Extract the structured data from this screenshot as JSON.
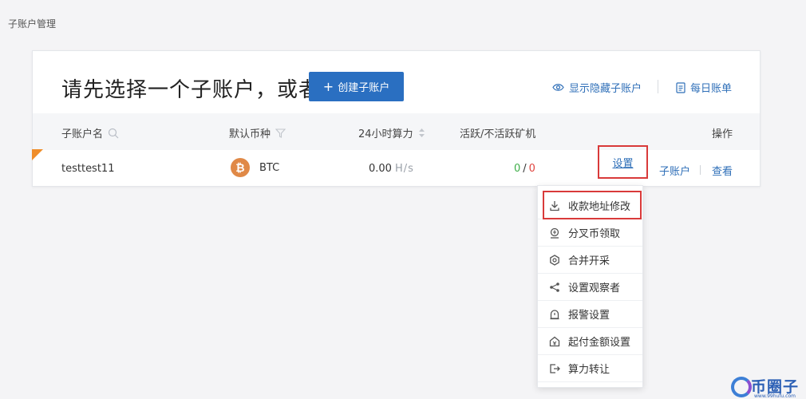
{
  "breadcrumb": "子账户管理",
  "header": {
    "title": "请先选择一个子账户，或者",
    "create_button": "创建子账户",
    "show_hidden_label": "显示隐藏子账户",
    "daily_bill_label": "每日账单"
  },
  "table": {
    "columns": {
      "name": "子账户名",
      "coin": "默认币种",
      "hashrate": "24小时算力",
      "active": "活跃/不活跃矿机",
      "actions": "操作"
    },
    "rows": [
      {
        "name": "testtest11",
        "coin": "BTC",
        "hashrate_value": "0.00",
        "hashrate_unit": "H/s",
        "active": "0",
        "inactive": "0",
        "actions": {
          "settings": "设置",
          "subaccount": "子账户",
          "view": "查看"
        }
      }
    ]
  },
  "settings_menu": {
    "items": [
      {
        "label": "收款地址修改",
        "icon": "address-edit-icon"
      },
      {
        "label": "分叉币领取",
        "icon": "fork-coin-icon"
      },
      {
        "label": "合并开采",
        "icon": "merge-mining-icon"
      },
      {
        "label": "设置观察者",
        "icon": "share-icon"
      },
      {
        "label": "报警设置",
        "icon": "alarm-icon"
      },
      {
        "label": "起付金额设置",
        "icon": "payout-threshold-icon"
      },
      {
        "label": "算力转让",
        "icon": "transfer-icon"
      }
    ]
  },
  "watermark": {
    "text": "币圈子",
    "url": "www.99hufu.com"
  },
  "colors": {
    "primary": "#2a6fc1",
    "link": "#2f6fb8",
    "highlight_box": "#d93a3a",
    "active_green": "#3fae4a",
    "inactive_red": "#e0443f",
    "btc_orange": "#e08947",
    "corner_flag": "#ef8d2a"
  }
}
